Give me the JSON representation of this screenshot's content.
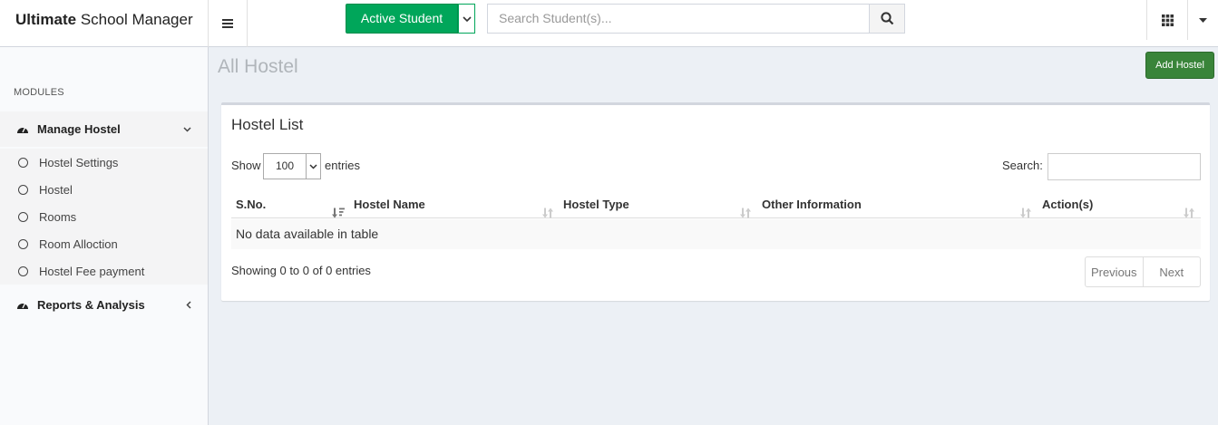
{
  "app": {
    "brand_bold": "Ultimate",
    "brand_rest": "School Manager"
  },
  "topbar": {
    "active_student_label": "Active Student",
    "search_placeholder": "Search Student(s)..."
  },
  "sidebar": {
    "section_label": "MODULES",
    "groups": [
      {
        "label": "Manage Hostel",
        "expanded": true,
        "items": [
          {
            "label": "Hostel Settings"
          },
          {
            "label": "Hostel"
          },
          {
            "label": "Rooms"
          },
          {
            "label": "Room Alloction"
          },
          {
            "label": "Hostel Fee payment"
          }
        ]
      },
      {
        "label": "Reports & Analysis",
        "expanded": false,
        "items": []
      }
    ]
  },
  "main": {
    "page_title": "All Hostel",
    "add_button_label": "Add Hostel",
    "box_title": "Hostel List",
    "show_label": "Show",
    "entries_select_value": "100",
    "entries_label": "entries",
    "search_label": "Search:",
    "search_value": "",
    "columns": [
      "S.No.",
      "Hostel Name",
      "Hostel Type",
      "Other Information",
      "Action(s)"
    ],
    "empty_message": "No data available in table",
    "info_text": "Showing 0 to 0 of 0 entries",
    "pagination": {
      "previous": "Previous",
      "next": "Next"
    }
  },
  "colors": {
    "accent_green": "#00a65a",
    "add_button": "#398439",
    "background": "#ecf0f5"
  }
}
